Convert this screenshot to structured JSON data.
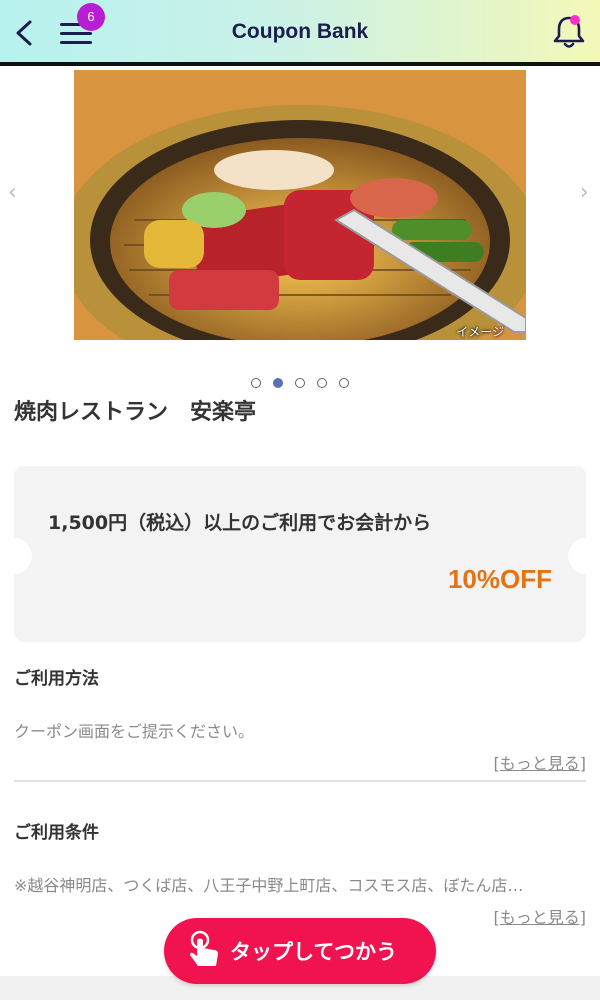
{
  "header": {
    "title": "Coupon Bank",
    "menu_badge": "6",
    "back_icon": "chevron-left-icon",
    "menu_icon": "hamburger-menu-icon",
    "bell_icon": "bell-icon"
  },
  "carousel": {
    "image_label": "イメージ",
    "slide_count": 5,
    "active_index": 1
  },
  "shop": {
    "name": "焼肉レストラン　安楽亭"
  },
  "coupon": {
    "condition": "1,500円（税込）以上のご利用でお会計から",
    "discount": "10%OFF"
  },
  "usage": {
    "title": "ご利用方法",
    "text": "クーポン画面をご提示ください。",
    "more": "[もっと見る]"
  },
  "conditions": {
    "title": "ご利用条件",
    "text": "※越谷神明店、つくば店、八王子中野上町店、コスモス店、ぼたん店…",
    "more": "[もっと見る]"
  },
  "action": {
    "label": "タップしてつかう"
  },
  "colors": {
    "accent": "#f0134f",
    "discount": "#e47314",
    "badge": "#b81fd4",
    "title": "#1b1d4d"
  }
}
